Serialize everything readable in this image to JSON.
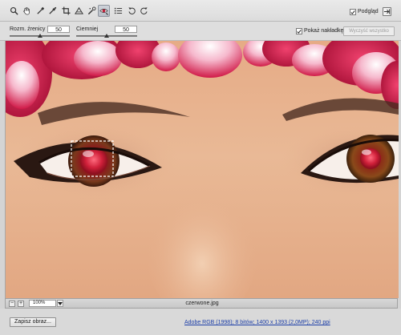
{
  "toolbar": {
    "tools": [
      {
        "name": "zoom-tool",
        "icon": "magnifier-icon",
        "active": false
      },
      {
        "name": "hand-tool",
        "icon": "hand-icon",
        "active": false
      },
      {
        "name": "eyedropper-tool",
        "icon": "eyedropper-icon",
        "active": false
      },
      {
        "name": "color-sampler-tool",
        "icon": "color-sampler-icon",
        "active": false
      },
      {
        "name": "crop-tool",
        "icon": "crop-icon",
        "active": false
      },
      {
        "name": "straighten-tool",
        "icon": "straighten-icon",
        "active": false
      },
      {
        "name": "spot-removal-tool",
        "icon": "spot-removal-icon",
        "active": false
      },
      {
        "name": "red-eye-tool",
        "icon": "red-eye-icon",
        "active": true
      },
      {
        "name": "preferences-tool",
        "icon": "list-icon",
        "active": false
      },
      {
        "name": "rotate-left-tool",
        "icon": "rotate-ccw-icon",
        "active": false
      },
      {
        "name": "rotate-right-tool",
        "icon": "rotate-cw-icon",
        "active": false
      }
    ],
    "preview_label": "Podgląd",
    "preview_checked": true
  },
  "options": {
    "pupil_size_label": "Rozm. źrenicy",
    "pupil_size_value": "50",
    "pupil_size_level": 0.5,
    "darken_label": "Ciemniej",
    "darken_value": "50",
    "darken_level": 0.5,
    "show_overlay_label": "Pokaż nakładkę",
    "show_overlay_checked": true,
    "clear_all_label": "Wyczyść wszystko"
  },
  "status": {
    "zoom_out_label": "−",
    "zoom_in_label": "+",
    "zoom_value": "100%",
    "filename": "czerwone.jpg"
  },
  "footer": {
    "save_label": "Zapisz obraz...",
    "image_info": "Adobe RGB (1998); 8 bitów; 1400 x 1393 (2,0MP); 240 ppi"
  },
  "colors": {
    "accent_link": "#1d3fa8",
    "selection_marquee": "#ffffff",
    "skin": "#e7b48f",
    "flower_red": "#d41f4a"
  }
}
